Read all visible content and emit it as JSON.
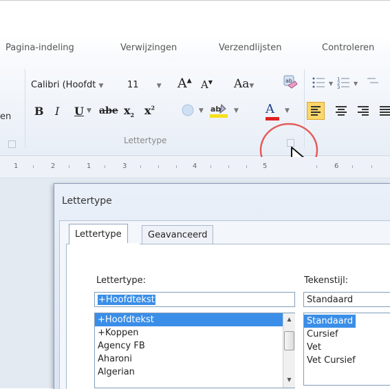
{
  "ribbon": {
    "tabs": [
      "Pagina-indeling",
      "Verwijzingen",
      "Verzendlijsten",
      "Controleren"
    ],
    "font_name": "Calibri (Hoofdt",
    "font_size": "11",
    "grow_font": "A",
    "shrink_font": "A",
    "change_case": "Aa",
    "bold": "B",
    "italic": "I",
    "underline": "U",
    "strikethrough": "abe",
    "subscript": "x",
    "superscript": "x",
    "font_color": "A",
    "partial_left": "en",
    "font_group_label": "Lettertype",
    "ruler_numbers": [
      "1",
      "2",
      "1",
      "3",
      "4",
      "5",
      "6"
    ]
  },
  "dialog": {
    "title": "Lettertype",
    "tabs": [
      "Lettertype",
      "Geavanceerd"
    ],
    "font_label": "Lettertype:",
    "font_value": "+Hoofdtekst",
    "font_list": [
      "+Hoofdtekst",
      "+Koppen",
      "Agency FB",
      "Aharoni",
      "Algerian"
    ],
    "style_label": "Tekenstijl:",
    "style_value": "Standaard",
    "style_list": [
      "Standaard",
      "Cursief",
      "Vet",
      "Vet Cursief"
    ]
  },
  "colors": {
    "selection": "#3a8ee8",
    "highlight_yellow": "#f5e11a",
    "font_color_red": "#e02020",
    "callout_circle": "#e35a5a"
  }
}
